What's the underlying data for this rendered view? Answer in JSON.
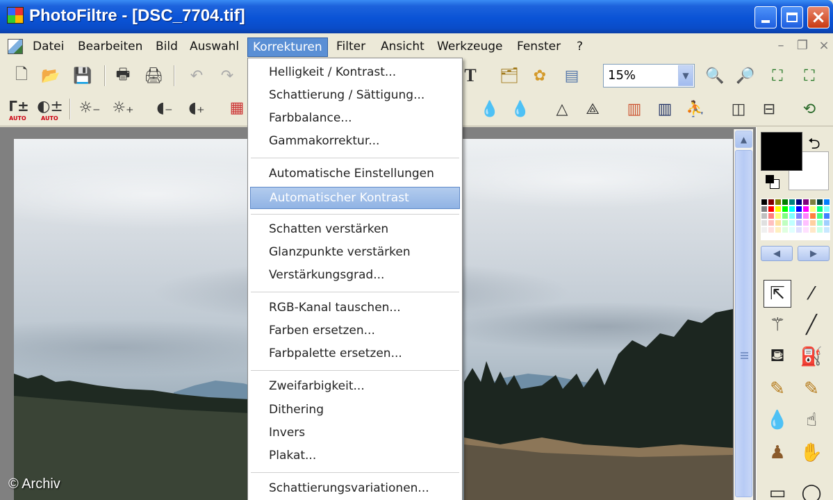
{
  "window": {
    "title": "PhotoFiltre - [DSC_7704.tif]",
    "controls": {
      "minimize": "minimize",
      "maximize": "maximize",
      "close": "×"
    }
  },
  "menubar": {
    "items": [
      "Datei",
      "Bearbeiten",
      "Bild",
      "Auswahl",
      "Korrekturen",
      "Filter",
      "Ansicht",
      "Werkzeuge",
      "Fenster",
      "?"
    ],
    "active": "Korrekturen",
    "mdi": {
      "minimize": "–",
      "restore": "❐",
      "close": "×"
    }
  },
  "toolbar": {
    "zoom_value": "15%",
    "auto_label": "AUTO"
  },
  "korrekturen_menu": {
    "group1": [
      "Helligkeit / Kontrast...",
      "Schattierung / Sättigung...",
      "Farbbalance...",
      "Gammakorrektur..."
    ],
    "group2": [
      "Automatische Einstellungen",
      "Automatischer Kontrast"
    ],
    "group3": [
      "Schatten verstärken",
      "Glanzpunkte verstärken",
      "Verstärkungsgrad..."
    ],
    "group4": [
      "RGB-Kanal tauschen...",
      "Farben ersetzen...",
      "Farbpalette ersetzen..."
    ],
    "group5": [
      "Zweifarbigkeit...",
      "Dithering",
      "Invers",
      "Plakat..."
    ],
    "group6": [
      "Schattierungsvariationen..."
    ],
    "highlighted": "Automatischer Kontrast"
  },
  "colors": {
    "foreground": "#000000",
    "background": "#FFFFFF",
    "menu_highlight": "#90B3E4",
    "titlebar": "#0A53D6"
  },
  "watermark": "© Archiv"
}
